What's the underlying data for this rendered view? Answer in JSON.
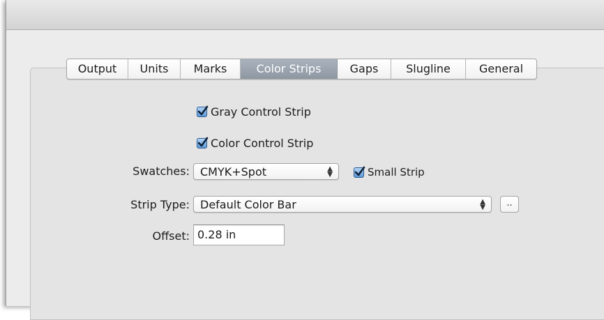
{
  "tabs": [
    {
      "label": "Output",
      "selected": false
    },
    {
      "label": "Units",
      "selected": false
    },
    {
      "label": "Marks",
      "selected": false
    },
    {
      "label": "Color Strips",
      "selected": true
    },
    {
      "label": "Gaps",
      "selected": false
    },
    {
      "label": "Slugline",
      "selected": false
    },
    {
      "label": "General",
      "selected": false
    }
  ],
  "gray_control_strip": {
    "label": "Gray Control Strip",
    "checked": true
  },
  "color_control_strip": {
    "label": "Color Control Strip",
    "checked": true
  },
  "swatches": {
    "label": "Swatches:",
    "value": "CMYK+Spot"
  },
  "small_strip": {
    "label": "Small Strip",
    "checked": true
  },
  "strip_type": {
    "label": "Strip Type:",
    "value": "Default Color Bar",
    "more_button": ".."
  },
  "offset": {
    "label": "Offset:",
    "value": "0.28 in"
  },
  "icons": {
    "checkmark": "checkmark-icon",
    "popup_arrows": "updown-arrows-icon"
  },
  "colors": {
    "selected_tab": "#9aa3ad",
    "checkbox_fill": "#5f99d6",
    "panel_bg": "#e4e4e4"
  }
}
